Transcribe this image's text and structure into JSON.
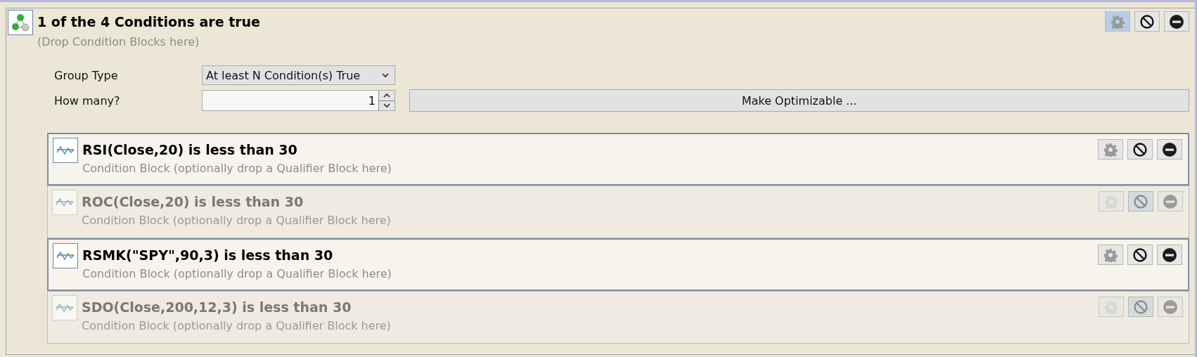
{
  "group": {
    "title": "1 of the 4 Conditions are true",
    "hint": "(Drop Condition Blocks here)",
    "settings_hovered": true
  },
  "form": {
    "group_type_label": "Group Type",
    "group_type_value": "At least N Condition(s) True",
    "how_many_label": "How many?",
    "how_many_value": "1",
    "optimize_button": "Make Optimizable ..."
  },
  "conditions": [
    {
      "title": "RSI(Close,20) is less than 30",
      "subtitle": "Condition Block (optionally drop a Qualifier Block here)",
      "disabled": false
    },
    {
      "title": "ROC(Close,20) is less than 30",
      "subtitle": "Condition Block (optionally drop a Qualifier Block here)",
      "disabled": true
    },
    {
      "title": "RSMK(\"SPY\",90,3) is less than 30",
      "subtitle": "Condition Block (optionally drop a Qualifier Block here)",
      "disabled": false
    },
    {
      "title": "SDO(Close,200,12,3) is less than 30",
      "subtitle": "Condition Block (optionally drop a Qualifier Block here)",
      "disabled": true
    }
  ]
}
